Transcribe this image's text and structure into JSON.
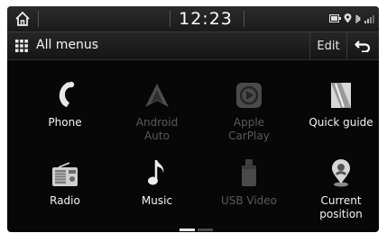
{
  "statusbar": {
    "clock": "12:23",
    "icons": [
      "home-icon",
      "battery-icon",
      "location-icon",
      "signal-icon"
    ]
  },
  "header": {
    "title": "All menus",
    "edit_label": "Edit",
    "menu_icon": "grid-icon",
    "back_icon": "back-arrow-icon"
  },
  "tiles": [
    {
      "label": "Phone",
      "icon": "phone-icon",
      "enabled": true
    },
    {
      "label": "Android\nAuto",
      "icon": "android-auto-icon",
      "enabled": false
    },
    {
      "label": "Apple\nCarPlay",
      "icon": "carplay-icon",
      "enabled": false
    },
    {
      "label": "Quick guide",
      "icon": "quick-guide-icon",
      "enabled": true
    },
    {
      "label": "Radio",
      "icon": "radio-icon",
      "enabled": true
    },
    {
      "label": "Music",
      "icon": "music-note-icon",
      "enabled": true
    },
    {
      "label": "USB Video",
      "icon": "usb-video-icon",
      "enabled": false
    },
    {
      "label": "Current\nposition",
      "icon": "location-pin-icon",
      "enabled": true
    }
  ],
  "pager": {
    "pages": 2,
    "current": 1
  },
  "colors": {
    "background": "#070707",
    "bar": "#1f1f1f",
    "text": "#f2f2f2",
    "disabled": "#5a5a5a"
  }
}
